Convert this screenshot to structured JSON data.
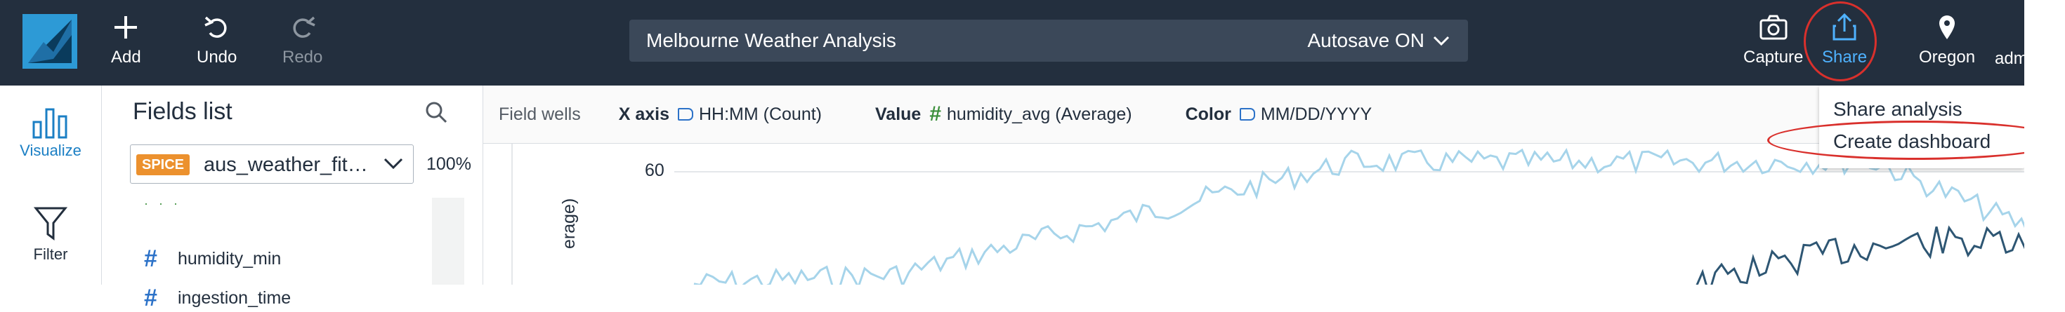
{
  "topbar": {
    "add_label": "Add",
    "undo_label": "Undo",
    "redo_label": "Redo",
    "analysis_title": "Melbourne Weather Analysis",
    "autosave_label": "Autosave ON",
    "capture_label": "Capture",
    "share_label": "Share",
    "region_label": "Oregon",
    "user_label": "adm",
    "colors": {
      "bar_bg": "#232f3e",
      "title_bg": "#3b4859",
      "share_accent": "#4fb2ff",
      "annotation_red": "#d9302c"
    }
  },
  "left_rail": {
    "items": [
      {
        "label": "Visualize",
        "icon": "bar-chart-icon",
        "active": true
      },
      {
        "label": "Filter",
        "icon": "filter-icon",
        "active": false
      }
    ],
    "active_color": "#1b7fc4"
  },
  "fields_panel": {
    "title": "Fields list",
    "dataset": {
      "badge": "SPICE",
      "name": "aus_weather_fit…",
      "percent": "100%"
    },
    "fields": [
      {
        "name": "humidity_min",
        "icon": "hash-icon"
      },
      {
        "name": "ingestion_time",
        "icon": "hash-icon"
      }
    ]
  },
  "field_wells": {
    "label": "Field wells",
    "x_axis": {
      "title": "X axis",
      "value": "HH:MM (Count)"
    },
    "value": {
      "title": "Value",
      "value": "humidity_avg (Average)"
    },
    "color": {
      "title": "Color",
      "value": "MM/DD/YYYY"
    }
  },
  "chart": {
    "y_tick": "60",
    "y_axis_label": "erage)",
    "series_colors": [
      "#a6d4ea",
      "#2e5673"
    ]
  },
  "share_menu": {
    "items": [
      "Share analysis",
      "Create dashboard"
    ]
  }
}
